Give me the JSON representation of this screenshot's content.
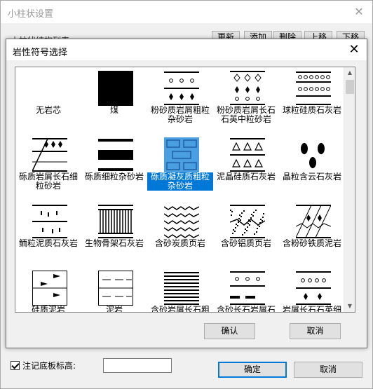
{
  "outer": {
    "title": "小柱状设置",
    "partial_label": "小柱状结构列表",
    "top_buttons": [
      "更新",
      "添加",
      "删除",
      "上移",
      "下移"
    ],
    "checkbox_label": "注记底板标高:",
    "checkbox_checked": true,
    "input_value": "",
    "ok_label": "确定",
    "cancel_label": "取消"
  },
  "dialog": {
    "title": "岩性符号选择",
    "ok_label": "确认",
    "cancel_label": "取消",
    "selected_index": 7,
    "items": [
      {
        "label": "无岩芯",
        "icon": "empty-core-icon"
      },
      {
        "label": "煤",
        "icon": "coal-icon"
      },
      {
        "label": "粉砂质岩屑粗粒杂砂岩",
        "icon": "silty-lithic-coarse-greywacke-icon"
      },
      {
        "label": "粉砂质岩屑长石石英中粒砂岩",
        "icon": "silty-lithic-feldspar-quartz-sandstone-icon"
      },
      {
        "label": "球粒硅质石灰岩",
        "icon": "pellet-siliceous-limestone-icon"
      },
      {
        "label": "砾质岩屑长石细粒砂岩",
        "icon": "gravelly-lithic-feldspar-fine-sandstone-icon"
      },
      {
        "label": "砾质细粒杂砂岩",
        "icon": "gravelly-fine-greywacke-icon"
      },
      {
        "label": "砾质凝灰质粗粒杂砂岩",
        "icon": "gravelly-tuffaceous-coarse-greywacke-icon"
      },
      {
        "label": "泥晶硅质石灰岩",
        "icon": "micritic-siliceous-limestone-icon"
      },
      {
        "label": "晶粒含云石灰岩",
        "icon": "crystalline-dolomitic-limestone-icon"
      },
      {
        "label": "鲕粒泥质石灰岩",
        "icon": "oolitic-argillaceous-limestone-icon"
      },
      {
        "label": "生物骨架石灰岩",
        "icon": "bio-framework-limestone-icon"
      },
      {
        "label": "含砂炭质页岩",
        "icon": "sandy-carbonaceous-shale-icon"
      },
      {
        "label": "含砂铝质页岩",
        "icon": "sandy-aluminous-shale-icon"
      },
      {
        "label": "含粉砂铁质泥岩",
        "icon": "silty-ferruginous-mudstone-icon"
      },
      {
        "label": "硅质泥岩",
        "icon": "siliceous-mudstone-icon"
      },
      {
        "label": "泥岩",
        "icon": "mudstone-icon"
      },
      {
        "label": "含砂岩屑长石粗",
        "icon": "sandy-lithic-feldspar-icon"
      },
      {
        "label": "含砂长石岩屑石",
        "icon": "sandy-feldspar-lithic-icon"
      },
      {
        "label": "岩屑长石石英细",
        "icon": "lithic-feldspar-quartz-fine-icon"
      }
    ]
  },
  "colors": {
    "selection": "#0078d7",
    "selected_icon_fill": "#4a9fe0"
  }
}
